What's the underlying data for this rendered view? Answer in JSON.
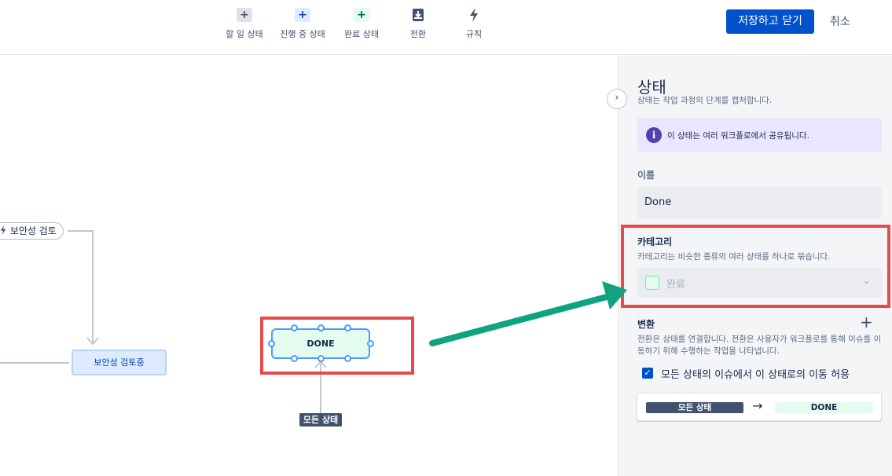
{
  "toolbar": {
    "tools": [
      {
        "icon": "plus-icon",
        "label": "할 일 상태"
      },
      {
        "icon": "plus-icon",
        "label": "진행 중 상태"
      },
      {
        "icon": "plus-icon",
        "label": "완료 상태"
      },
      {
        "icon": "transition-icon",
        "label": "전환"
      },
      {
        "icon": "bolt-icon",
        "label": "규칙"
      }
    ],
    "save_label": "저장하고 닫기",
    "cancel_label": "취소"
  },
  "canvas": {
    "security_node": "보안성 검토",
    "inprogress_node": "보안성 검토중",
    "done_node": "DONE",
    "all_status_tag": "모든 상태"
  },
  "panel": {
    "title": "상태",
    "subtitle": "상태는 작업 과정의 단계를 캡처합니다.",
    "info_text": "이 상태는 여러 워크플로에서 공유됩니다.",
    "name_label": "이름",
    "name_value": "Done",
    "category_label": "카테고리",
    "category_desc": "카테고리는 비슷한 종류의 여러 상태를 하나로 묶습니다.",
    "category_value": "완료",
    "transitions_label": "변환",
    "transitions_desc": "전환은 상태를 연결합니다. 전환은 사용자가 워크플로를 통해 이슈를 이동하기 위해 수행하는 작업을 나타냅니다.",
    "allow_all_label": "모든 상태의 이슈에서 이 상태로의 이동 허용",
    "allow_all_checked": true,
    "transition_from": "모든 상태",
    "transition_to": "DONE"
  },
  "colors": {
    "primary": "#0052cc",
    "done_green": "#e3fcef",
    "highlight_red": "#e84a4a",
    "arrow_green": "#0fa37f",
    "info_purple": "#5243aa"
  }
}
